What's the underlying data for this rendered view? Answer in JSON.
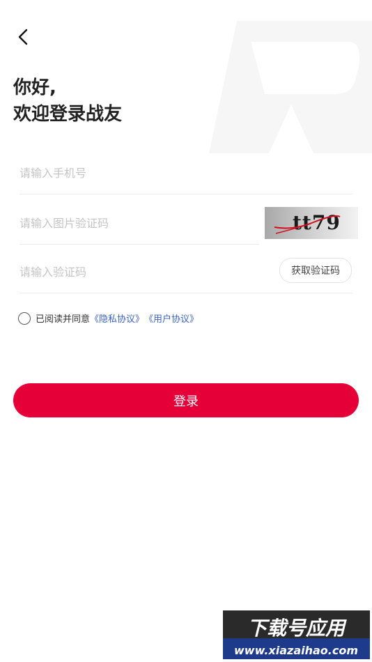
{
  "greeting": {
    "line1": "你好,",
    "line2": "欢迎登录战友"
  },
  "form": {
    "phone_placeholder": "请输入手机号",
    "captcha_placeholder": "请输入图片验证码",
    "captcha_text": "tt79",
    "code_placeholder": "请输入验证码",
    "get_code_label": "获取验证码"
  },
  "agreement": {
    "prefix": "已阅读并同意",
    "privacy_link": "《隐私协议》",
    "user_link": "《用户协议》"
  },
  "login_label": "登录",
  "watermark": {
    "line1": "下载号应用",
    "line2": "www.xiazaihao.com"
  },
  "colors": {
    "primary": "#e50038",
    "link": "#3a62c9",
    "placeholder": "#c4c4c4"
  },
  "icons": {
    "back": "chevron-left-icon",
    "background": "brand-logo-r",
    "radio": "radio-unchecked-icon"
  }
}
